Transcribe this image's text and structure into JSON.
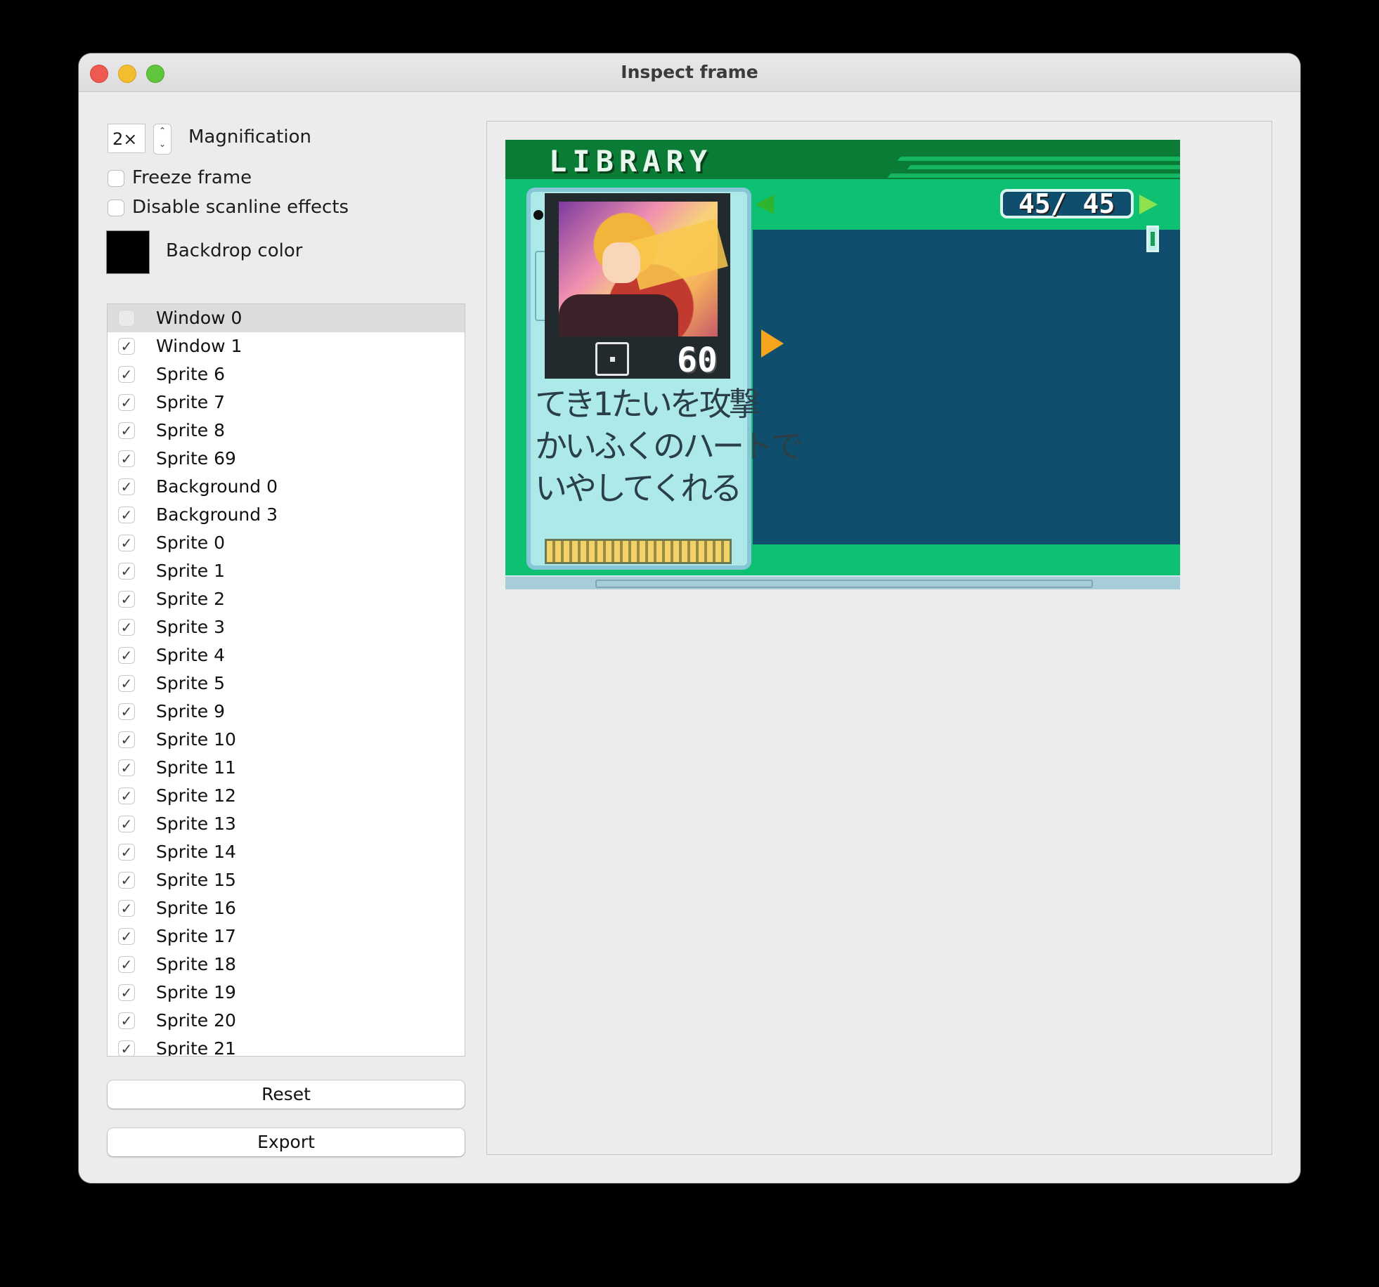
{
  "window": {
    "title": "Inspect frame"
  },
  "controls": {
    "magnification_value": "2×",
    "magnification_label": "Magnification",
    "freeze_frame_label": "Freeze frame",
    "freeze_frame_checked": false,
    "disable_scanline_label": "Disable scanline effects",
    "disable_scanline_checked": false,
    "backdrop_color_label": "Backdrop color",
    "backdrop_color": "#000000"
  },
  "layers": [
    {
      "label": "Window 0",
      "checked": false,
      "selected": true
    },
    {
      "label": "Window 1",
      "checked": true
    },
    {
      "label": "Sprite 6",
      "checked": true
    },
    {
      "label": "Sprite 7",
      "checked": true
    },
    {
      "label": "Sprite 8",
      "checked": true
    },
    {
      "label": "Sprite 69",
      "checked": true
    },
    {
      "label": "Background 0",
      "checked": true
    },
    {
      "label": "Background 3",
      "checked": true
    },
    {
      "label": "Sprite 0",
      "checked": true
    },
    {
      "label": "Sprite 1",
      "checked": true
    },
    {
      "label": "Sprite 2",
      "checked": true
    },
    {
      "label": "Sprite 3",
      "checked": true
    },
    {
      "label": "Sprite 4",
      "checked": true
    },
    {
      "label": "Sprite 5",
      "checked": true
    },
    {
      "label": "Sprite 9",
      "checked": true
    },
    {
      "label": "Sprite 10",
      "checked": true
    },
    {
      "label": "Sprite 11",
      "checked": true
    },
    {
      "label": "Sprite 12",
      "checked": true
    },
    {
      "label": "Sprite 13",
      "checked": true
    },
    {
      "label": "Sprite 14",
      "checked": true
    },
    {
      "label": "Sprite 15",
      "checked": true
    },
    {
      "label": "Sprite 16",
      "checked": true
    },
    {
      "label": "Sprite 17",
      "checked": true
    },
    {
      "label": "Sprite 18",
      "checked": true
    },
    {
      "label": "Sprite 19",
      "checked": true
    },
    {
      "label": "Sprite 20",
      "checked": true
    },
    {
      "label": "Sprite 21",
      "checked": true
    }
  ],
  "buttons": {
    "reset": "Reset",
    "export": "Export"
  },
  "game": {
    "header": "LIBRARY",
    "counter": "45/ 45",
    "attack": "60",
    "description": [
      "てき1たいを攻撃",
      "かいふくのハートで",
      "いやしてくれる"
    ],
    "colors": {
      "green": "#0ec071",
      "dark_green": "#0a7c35",
      "panel": "#104e6e",
      "card": "#aee9ea"
    }
  },
  "icons": {
    "check": "checkmark-icon",
    "stepper": "up-down-chevron-icon"
  }
}
